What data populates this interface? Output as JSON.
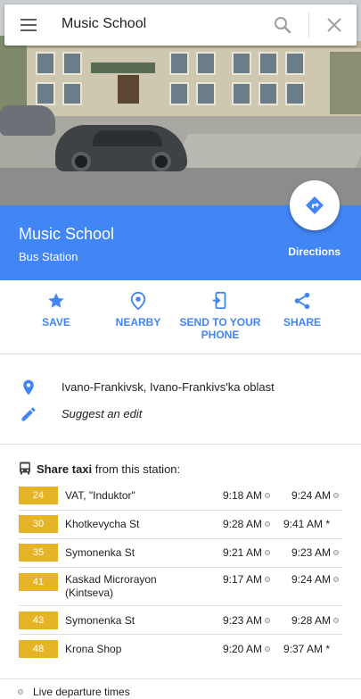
{
  "search": {
    "query": "Music School",
    "menu_icon": "menu-icon",
    "search_icon": "search-icon",
    "close_icon": "close-icon"
  },
  "place": {
    "title": "Music School",
    "subtitle": "Bus Station",
    "directions_label": "Directions",
    "accent_color": "#4285f4"
  },
  "actions": [
    {
      "label": "SAVE",
      "icon": "star-icon"
    },
    {
      "label": "NEARBY",
      "icon": "nearby-icon"
    },
    {
      "label": "SEND TO YOUR PHONE",
      "icon": "send-to-phone-icon"
    },
    {
      "label": "SHARE",
      "icon": "share-icon"
    }
  ],
  "info": {
    "address": "Ivano-Frankivsk, Ivano-Frankivs'ka oblast",
    "suggest_edit": "Suggest an edit"
  },
  "transit": {
    "heading_bold": "Share taxi",
    "heading_rest": " from this station:",
    "badge_color": "#e5b527",
    "routes": [
      {
        "number": "24",
        "name": "VAT, \"Induktor\"",
        "time1": "9:18 AM",
        "time2": "9:24 AM",
        "time2_mark": "dot"
      },
      {
        "number": "30",
        "name": "Khotkevycha St",
        "time1": "9:28 AM",
        "time2": "9:41 AM *",
        "time2_mark": "none"
      },
      {
        "number": "35",
        "name": "Symonenka St",
        "time1": "9:21 AM",
        "time2": "9:23 AM",
        "time2_mark": "dot"
      },
      {
        "number": "41",
        "name": "Kaskad Microrayon (Kintseva)",
        "time1": "9:17 AM",
        "time2": "9:24 AM",
        "time2_mark": "dot"
      },
      {
        "number": "43",
        "name": "Symonenka St",
        "time1": "9:23 AM",
        "time2": "9:28 AM",
        "time2_mark": "dot"
      },
      {
        "number": "48",
        "name": "Krona Shop",
        "time1": "9:20 AM",
        "time2": "9:37 AM *",
        "time2_mark": "none"
      }
    ],
    "footer": "Live departure times"
  }
}
